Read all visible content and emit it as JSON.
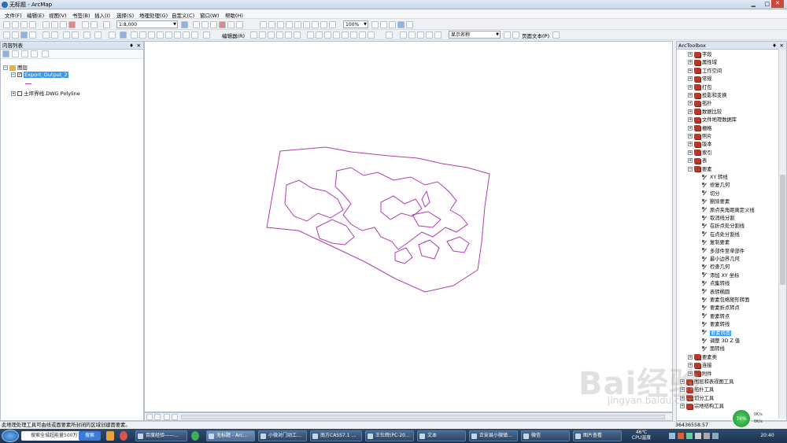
{
  "window": {
    "title": "无标题 - ArcMap"
  },
  "menu": [
    "文件(F)",
    "编辑(E)",
    "视图(V)",
    "书签(B)",
    "插入(I)",
    "选择(S)",
    "地理处理(G)",
    "自定义(C)",
    "窗口(W)",
    "帮助(H)"
  ],
  "toolbar": {
    "scale": "1:8,000",
    "zoom": "100%",
    "editor_label": "编辑器(R)",
    "display_name": "显示名称",
    "page_text": "页面文本(P)"
  },
  "toc": {
    "title": "内容列表",
    "group_label": "图层",
    "layer1": "Export_Output_2",
    "layer2": "土坪界线.DWG Polyline"
  },
  "toolbox": {
    "title": "ArcToolbox",
    "top_items": [
      "字段",
      "属性域",
      "工作空间",
      "常规",
      "打包",
      "投影和变换",
      "拓扑",
      "数据比较",
      "文件地理数据库",
      "栅格",
      "照片",
      "版本",
      "索引",
      "表",
      "要素"
    ],
    "feature_tools": [
      "XY 转线",
      "修复几何",
      "切分",
      "删除要素",
      "原点夹角距离定义线",
      "取消线分割",
      "在折点处分割线",
      "在点处分割线",
      "复制要素",
      "多部件至单部件",
      "最小边界几何",
      "检查几何",
      "添加 XY 坐标",
      "点集转线",
      "表转椭圆",
      "要素包络矩形转面",
      "要素折点转点",
      "要素转点",
      "要素转线",
      "要素转面",
      "调整 3D Z 值",
      "面转线"
    ],
    "bottom_items": [
      "要素类",
      "连接",
      "附件",
      "图层和表视图工具",
      "拓扑工具",
      "切分工具",
      "宗地结构工具"
    ],
    "selected_tool": "要素转面"
  },
  "statusbar": {
    "message": "此地理处理工具可由线或面要素所封闭的区域创建面要素。",
    "coords": "36436558.57"
  },
  "taskbar": {
    "search_placeholder": "搜索全城超能量500万",
    "search_button": "搜索",
    "tasks": [
      "百度经验——…",
      "无标题 - Arc…",
      "小微对门动工…",
      "南方CASS7.1 …",
      "王仕辉(PC-20…",
      "文本",
      "正安县小微镇…",
      "微信",
      "图片查看"
    ],
    "temp": "46℃",
    "cpu": "CPU温度",
    "time": "20:40"
  },
  "overlay": {
    "watermark": "Bai经验",
    "watermark_url": "jingyan.baidu.com",
    "net_badge": "74%",
    "net_up": "0K/s",
    "net_down": "0K/s"
  }
}
